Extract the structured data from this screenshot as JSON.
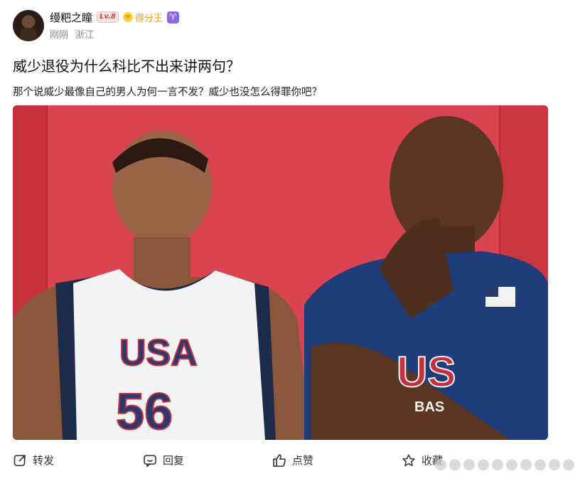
{
  "post": {
    "author": {
      "name": "缦粑之瞳",
      "level": "Lv.8",
      "badge": "得分王",
      "zodiac_symbol": "♈"
    },
    "time": "刚刚",
    "location": "浙江",
    "title": "威少退役为什么科比不出来讲两句？",
    "body": "那个说威少最像自己的男人为何一言不发？威少也没怎么得罪你吧？",
    "image": {
      "left_jersey_text": "USA",
      "left_jersey_number": "56",
      "right_jersey_text": "US",
      "right_jersey_subtext": "BAS"
    }
  },
  "actions": {
    "repost": "转发",
    "reply": "回复",
    "like": "点赞",
    "favorite": "收藏"
  },
  "icons": {
    "repost": "share-icon",
    "reply": "comment-icon",
    "like": "thumb-up-icon",
    "favorite": "star-icon",
    "badge": "diamond-icon"
  },
  "colors": {
    "badge": "#f09b1a",
    "level": "#d5433f",
    "zodiac": "#8b67e6",
    "background_wall": "#d73e4a"
  }
}
